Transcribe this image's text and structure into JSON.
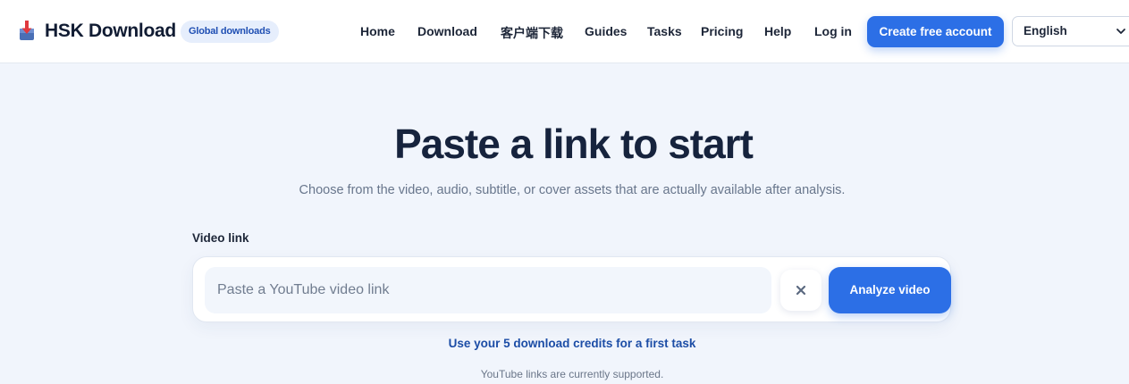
{
  "header": {
    "brand": {
      "name": "HSK Download",
      "badge": "Global downloads",
      "logo_icon": "download-box-icon"
    },
    "nav": [
      {
        "label": "Home"
      },
      {
        "label": "Download"
      },
      {
        "label": "客户端下载"
      },
      {
        "label": "Guides"
      },
      {
        "label": "Tasks"
      },
      {
        "label": "Pricing"
      },
      {
        "label": "Help"
      },
      {
        "label": "Log in"
      }
    ],
    "cta_label": "Create free account",
    "language": {
      "selected": "English",
      "icon": "chevron-down-icon"
    }
  },
  "hero": {
    "title": "Paste a link to start",
    "subtitle": "Choose from the video, audio, subtitle, or cover assets that are actually available after analysis."
  },
  "form": {
    "label": "Video link",
    "input_value": "",
    "input_placeholder": "Paste a YouTube video link",
    "clear_icon": "close-icon",
    "analyze_label": "Analyze video"
  },
  "credits_link": "Use your 5 download credits for a first task",
  "support_note": "YouTube links are currently supported.",
  "colors": {
    "accent": "#2c6fe6",
    "badge_bg": "#e6eefc",
    "badge_text": "#1f4fb3",
    "page_bg": "#f1f5fc",
    "heading": "#16233d",
    "link": "#1c4da6"
  }
}
